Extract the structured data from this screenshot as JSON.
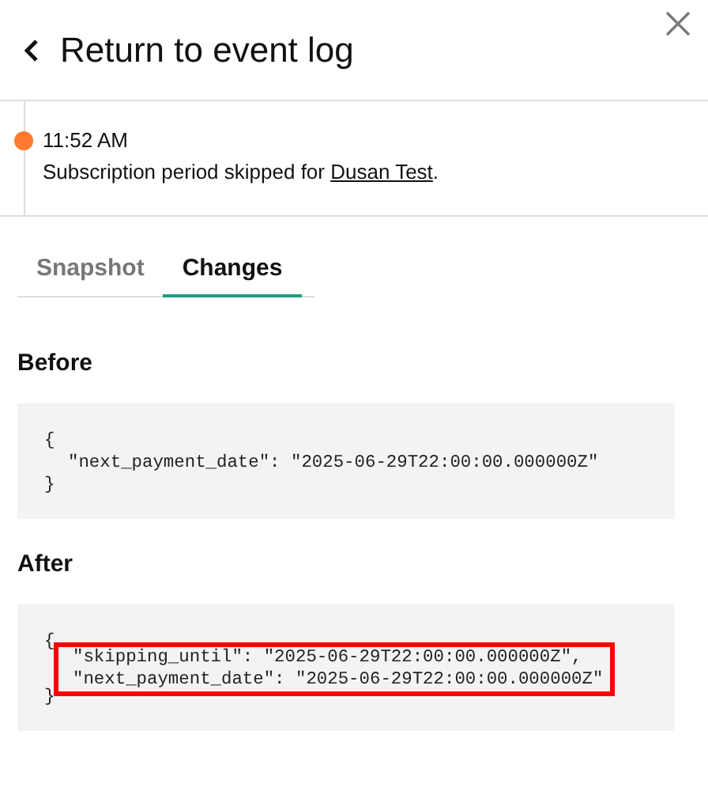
{
  "header": {
    "back_label": "Return to event log"
  },
  "event": {
    "time": "11:52 AM",
    "text_before": "Subscription period skipped for ",
    "link": "Dusan Test",
    "text_after": ".",
    "color": "#ff7a2f"
  },
  "tabs": [
    {
      "label": "Snapshot",
      "selected": false
    },
    {
      "label": "Changes",
      "selected": true
    }
  ],
  "sections": [
    {
      "title": "Before",
      "open": "{",
      "lines": [
        "\"next_payment_date\": \"2025-06-29T22:00:00.000000Z\""
      ],
      "close": "}",
      "highlighted": false
    },
    {
      "title": "After",
      "open": "{",
      "lines": [
        "\"skipping_until\": \"2025-06-29T22:00:00.000000Z\",",
        "\"next_payment_date\": \"2025-06-29T22:00:00.000000Z\""
      ],
      "close": "}",
      "highlighted": true
    }
  ]
}
